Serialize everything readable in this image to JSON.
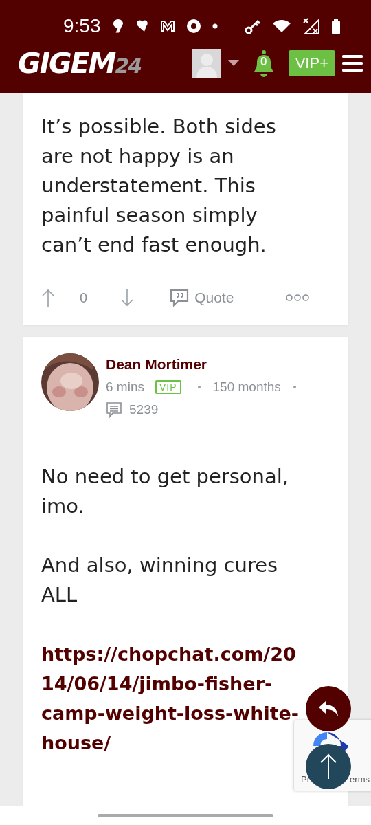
{
  "status_bar": {
    "time": "9:53"
  },
  "header": {
    "logo": {
      "main": "GIGEM",
      "suffix": "24"
    },
    "notifications": "0",
    "vip_button": "VIP+"
  },
  "top_post": {
    "body": "It’s possible. Both sides are not happy is an understatement. This painful season simply can’t end fast enough.",
    "score": "0",
    "quote": "Quote"
  },
  "post": {
    "author": "Dean Mortimer",
    "time": "6 mins",
    "badge": "VIP",
    "tenure": "150 months",
    "post_count": "5239",
    "body": [
      {
        "kind": "text",
        "text": "No need to get personal, imo."
      },
      {
        "kind": "text",
        "text": "And also, winning cures ALL"
      },
      {
        "kind": "link",
        "text": "https://chopchat.com/2014/06/14/jimbo-fisher-camp-weight-loss-white-house/"
      }
    ]
  },
  "recaptcha": {
    "left": "Pr",
    "right": "erms"
  }
}
